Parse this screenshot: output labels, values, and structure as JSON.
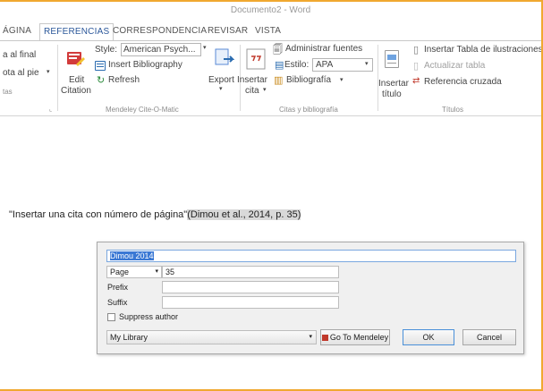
{
  "window": {
    "title": "Documento2 - Word"
  },
  "tabs": [
    "ÁGINA",
    "REFERENCIAS",
    "CORRESPONDENCIA",
    "REVISAR",
    "VISTA"
  ],
  "ribbon": {
    "footnotes": {
      "line1": "a al final",
      "line2": "ota al pie",
      "group_label": "tas"
    },
    "mendeley": {
      "edit_citation_line1": "Edit",
      "edit_citation_line2": "Citation",
      "style_label": "Style:",
      "style_value": "American Psych...",
      "insert_bibliography": "Insert Bibliography",
      "refresh": "Refresh",
      "export": "Export",
      "group_label": "Mendeley Cite-O-Matic"
    },
    "citations": {
      "insert_line1": "Insertar",
      "insert_line2": "cita",
      "manage_sources": "Administrar fuentes",
      "style_label": "Estilo:",
      "style_value": "APA",
      "bibliography": "Bibliografía",
      "group_label": "Citas y bibliografía"
    },
    "captions": {
      "insert_line1": "Insertar",
      "insert_line2": "título",
      "insert_table_figures": "Insertar Tabla de ilustraciones",
      "update_table": "Actualizar tabla",
      "cross_reference": "Referencia cruzada",
      "group_label": "Títulos"
    }
  },
  "document": {
    "sentence": "\"Insertar una cita con número de página\"",
    "citation": "(Dimou et al., 2014, p. 35)"
  },
  "dialog": {
    "search_value": "Dimou 2014",
    "locator_type": "Page",
    "locator_value": "35",
    "prefix_label": "Prefix",
    "suffix_label": "Suffix",
    "suppress_label": "Suppress author",
    "library_value": "My Library",
    "go_to_mendeley": "Go To Mendeley",
    "ok": "OK",
    "cancel": "Cancel"
  }
}
